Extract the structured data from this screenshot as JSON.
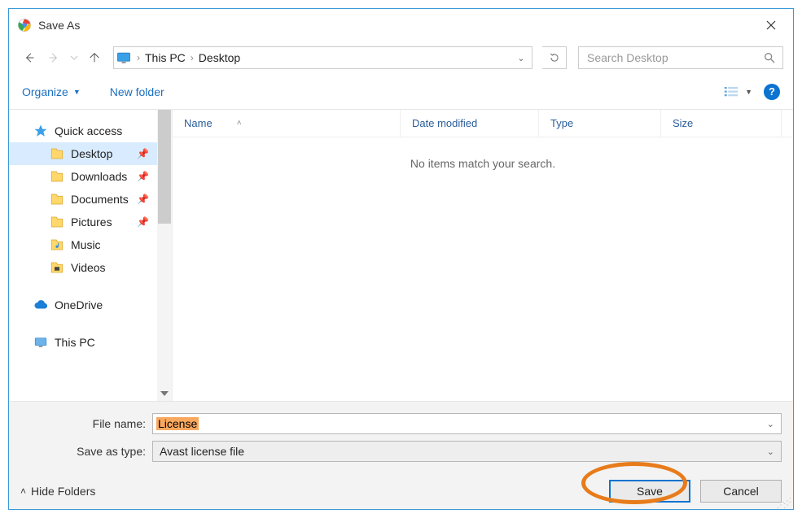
{
  "window_title": "Save As",
  "breadcrumb": {
    "root": "This PC",
    "current": "Desktop"
  },
  "search_placeholder": "Search Desktop",
  "toolbar": {
    "organize": "Organize",
    "new_folder": "New folder",
    "help_glyph": "?"
  },
  "nav": {
    "items": [
      {
        "label": "Quick access",
        "type": "quickaccess",
        "sub": false,
        "pinned": false,
        "selected": false
      },
      {
        "label": "Desktop",
        "type": "folder",
        "sub": true,
        "pinned": true,
        "selected": true
      },
      {
        "label": "Downloads",
        "type": "folder",
        "sub": true,
        "pinned": true,
        "selected": false
      },
      {
        "label": "Documents",
        "type": "folder",
        "sub": true,
        "pinned": true,
        "selected": false
      },
      {
        "label": "Pictures",
        "type": "folder",
        "sub": true,
        "pinned": true,
        "selected": false
      },
      {
        "label": "Music",
        "type": "music",
        "sub": true,
        "pinned": false,
        "selected": false
      },
      {
        "label": "Videos",
        "type": "video",
        "sub": true,
        "pinned": false,
        "selected": false
      },
      {
        "label": "OneDrive",
        "type": "cloud",
        "sub": false,
        "pinned": false,
        "selected": false,
        "gap_before": true
      },
      {
        "label": "This PC",
        "type": "pc",
        "sub": false,
        "pinned": false,
        "selected": false,
        "gap_before": true
      }
    ]
  },
  "columns": {
    "name": "Name",
    "date": "Date modified",
    "type": "Type",
    "size": "Size"
  },
  "empty_message": "No items match your search.",
  "file_name_label": "File name:",
  "file_name_value": "License",
  "save_type_label": "Save as type:",
  "save_type_value": "Avast license file",
  "hide_folders": "Hide Folders",
  "buttons": {
    "save": "Save",
    "cancel": "Cancel"
  }
}
